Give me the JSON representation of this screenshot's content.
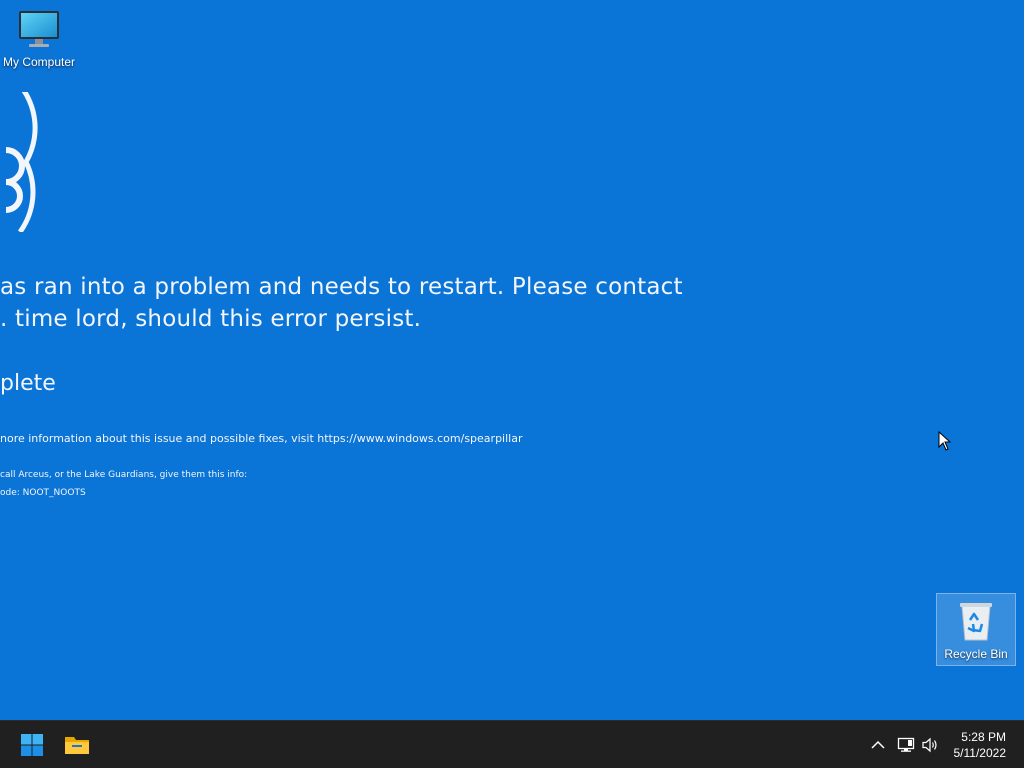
{
  "desktop": {
    "background_color": "#0b74d7",
    "icons": [
      {
        "label": "My Computer",
        "icon": "monitor-icon"
      },
      {
        "label": "Recycle Bin",
        "icon": "recycle-bin-icon"
      }
    ],
    "message": {
      "line1": "as ran into a problem and needs to restart. Please contact",
      "line2": ". time lord, should this error persist.",
      "progress": "plete",
      "info": "nore information about this issue and possible fixes, visit https://www.windows.com/spearpillar",
      "contact": "call Arceus, or the Lake Guardians, give them this info:",
      "stop_code": "ode: NOOT_NOOTS"
    }
  },
  "taskbar": {
    "background_color": "#202020",
    "apps": [
      {
        "icon": "windows-start-icon"
      },
      {
        "icon": "file-explorer-icon"
      }
    ],
    "tray": [
      {
        "icon": "chevron-up-icon"
      },
      {
        "icon": "network-icon"
      },
      {
        "icon": "volume-icon"
      }
    ],
    "clock": {
      "time": "5:28 PM",
      "date": "5/11/2022"
    }
  }
}
